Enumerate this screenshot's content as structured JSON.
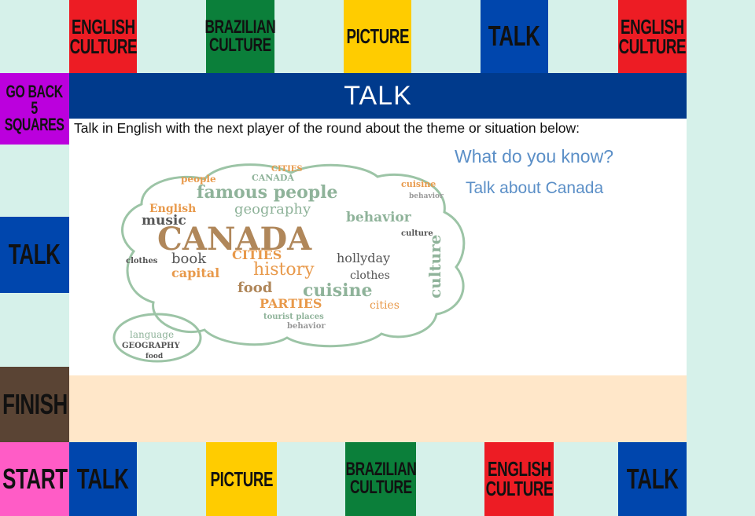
{
  "top_row": [
    {
      "label": "ENGLISH\nCULTURE",
      "color": "#ed1c24"
    },
    {
      "label": "BRAZILIAN\nCULTURE",
      "color": "#0b7f3a"
    },
    {
      "label": "PICTURE",
      "color": "#ffcc00"
    },
    {
      "label": "TALK",
      "color": "#0046ad"
    },
    {
      "label": "ENGLISH\nCULTURE",
      "color": "#ed1c24"
    }
  ],
  "left_col": [
    {
      "label": "GO BACK\n5 SQUARES",
      "color": "#bb00dd"
    },
    {
      "label": "TALK",
      "color": "#0046ad"
    },
    {
      "label": "FINISH",
      "color": "#5a4434"
    }
  ],
  "bottom_row": [
    {
      "label": "START",
      "color": "#ff5cc6"
    },
    {
      "label": "TALK",
      "color": "#0046ad"
    },
    {
      "label": "PICTURE",
      "color": "#ffcc00"
    },
    {
      "label": "BRAZILIAN\nCULTURE",
      "color": "#0b7f3a"
    },
    {
      "label": "ENGLISH\nCULTURE",
      "color": "#ed1c24"
    },
    {
      "label": "TALK",
      "color": "#0046ad"
    }
  ],
  "card": {
    "title": "TALK",
    "instruction": "Talk in English with the next player of the round about the theme or situation below:",
    "question1": "What do you know?",
    "question2": "Talk about Canada"
  },
  "word_cloud": {
    "words": [
      "CANADA",
      "famous people",
      "geography",
      "behavior",
      "music",
      "English",
      "CITIES",
      "history",
      "capital",
      "food",
      "cuisine",
      "PARTIES",
      "book",
      "clothes",
      "hollyday",
      "culture",
      "tourist places",
      "people",
      "cities",
      "BOOK",
      "CAPITAL",
      "language",
      "GEOGRAPHY",
      "behavior",
      "cities",
      "CANADA",
      "food"
    ]
  }
}
